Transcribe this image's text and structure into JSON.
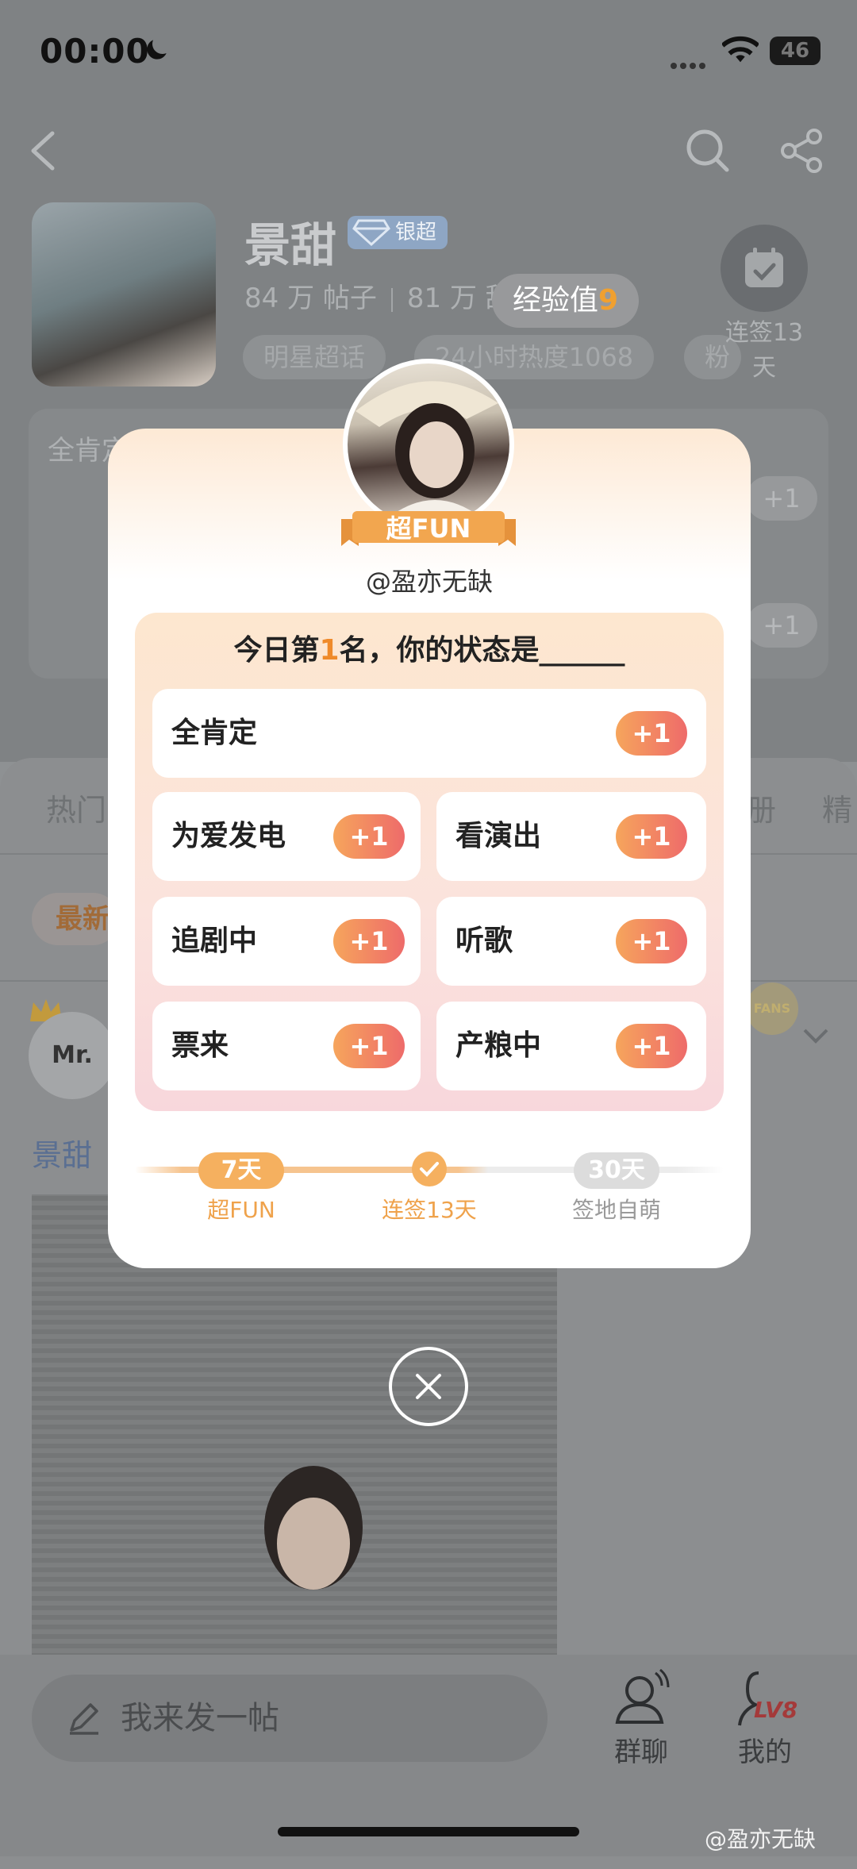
{
  "status_bar": {
    "time": "00:00",
    "battery": "46"
  },
  "topic": {
    "name": "景甜",
    "level_badge": "银超",
    "stats": [
      "84 万 帖子",
      "81 万 甜..."
    ],
    "chips": [
      "明星超话",
      "24小时热度1068",
      "粉"
    ],
    "checkin": "连签13天"
  },
  "exp_tip": {
    "label": "经验值",
    "value": "9"
  },
  "bg_card": {
    "label": "全肯定",
    "plus": "+1"
  },
  "tabs": [
    "热门",
    "册",
    "精"
  ],
  "latest_label": "最新",
  "user": {
    "initials": "Mr.",
    "fans_badge": "FANS"
  },
  "topic_tag": "景甜",
  "bottom": {
    "post_placeholder": "我来发一帖",
    "group_chat": "群聊",
    "mine": "我的",
    "level": "LV8"
  },
  "watermark": "@盈亦无缺",
  "modal": {
    "ribbon": "超FUN",
    "handle": "@盈亦无缺",
    "question_prefix": "今日第",
    "rank": "1",
    "question_suffix": "名，你的状态是______",
    "options": [
      {
        "label": "全肯定",
        "plus": "+1"
      },
      {
        "label": "为爱发电",
        "plus": "+1"
      },
      {
        "label": "看演出",
        "plus": "+1"
      },
      {
        "label": "追剧中",
        "plus": "+1"
      },
      {
        "label": "听歌",
        "plus": "+1"
      },
      {
        "label": "票来",
        "plus": "+1"
      },
      {
        "label": "产粮中",
        "plus": "+1"
      }
    ],
    "progress": [
      {
        "pill": "7天",
        "label": "超FUN"
      },
      {
        "pill": "",
        "label": "连签13天"
      },
      {
        "pill": "30天",
        "label": "签地自萌"
      }
    ]
  },
  "colors": {
    "accent_orange": "#ef8a2a",
    "plus_gradient_start": "#f6a55c",
    "plus_gradient_end": "#ee6b6a"
  }
}
